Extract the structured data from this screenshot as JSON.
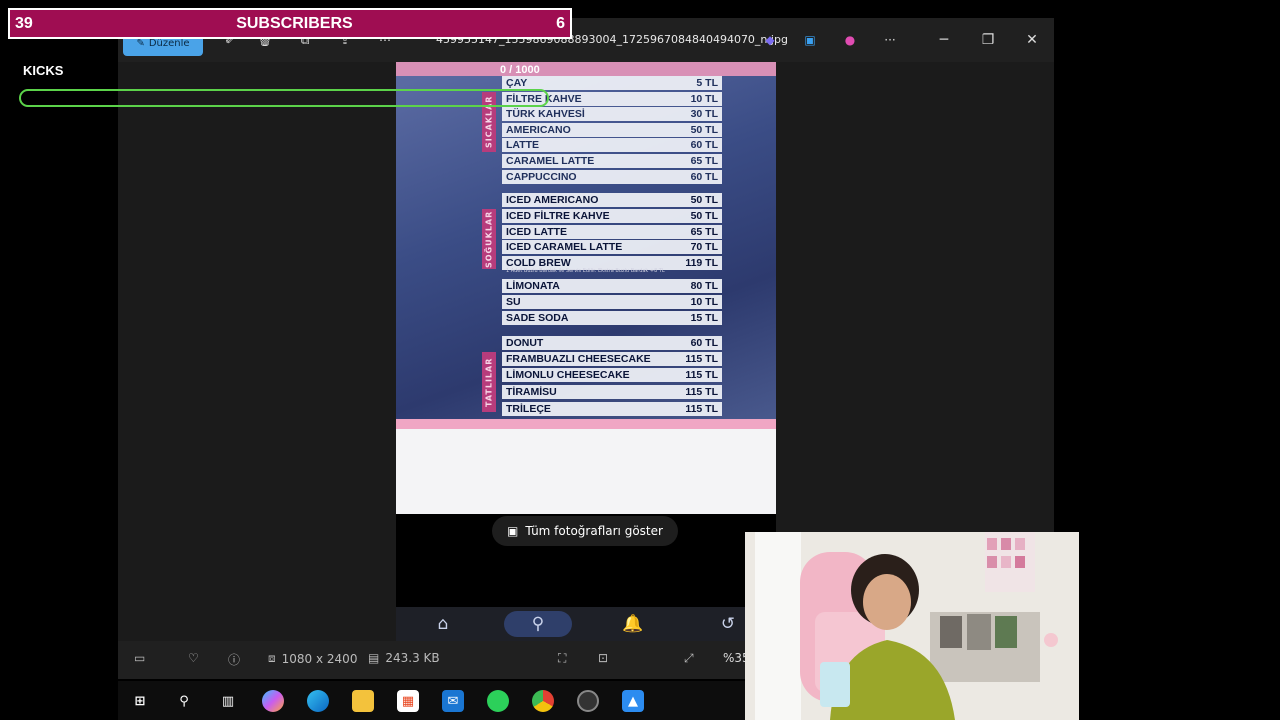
{
  "overlay": {
    "left_count": "39",
    "title": "SUBSCRIBERS",
    "right_count": "6",
    "kicks_label": "KICKS",
    "kicks_counter": "0 / 1000",
    "kicks_progress": 0.0,
    "kicks_color": "#5cd34a",
    "banner_color": "#9f0d52"
  },
  "titlebar": {
    "edit_label": "Düzenle",
    "filename": "459955147_1559869088893004_1725967084840494070_n.jpg",
    "more_icon": "ellipsis-icon",
    "minimize_icon": "minimize-icon",
    "maximize_icon": "restore-icon",
    "close_icon": "close-icon"
  },
  "menu": {
    "sections": [
      {
        "name": "SICAKLAR",
        "items": [
          {
            "name": "ÇAY",
            "price": "5 TL"
          },
          {
            "name": "FİLTRE KAHVE",
            "price": "10 TL"
          },
          {
            "name": "TÜRK KAHVESİ",
            "price": "30 TL"
          },
          {
            "name": "AMERICANO",
            "price": "50 TL"
          },
          {
            "name": "LATTE",
            "price": "60 TL"
          },
          {
            "name": "CARAMEL LATTE",
            "price": "65 TL"
          },
          {
            "name": "CAPPUCCINO",
            "price": "60 TL"
          }
        ]
      },
      {
        "name": "SOĞUKLAR",
        "items": [
          {
            "name": "ICED AMERICANO",
            "price": "50 TL"
          },
          {
            "name": "ICED FİLTRE KAHVE",
            "price": "50 TL"
          },
          {
            "name": "ICED LATTE",
            "price": "65 TL"
          },
          {
            "name": "ICED CARAMEL LATTE",
            "price": "70 TL"
          },
          {
            "name": "COLD BREW",
            "price": "119 TL"
          },
          {
            "name": "LİMONATA",
            "price": "80 TL"
          },
          {
            "name": "SU",
            "price": "10 TL"
          },
          {
            "name": "SADE SODA",
            "price": "15 TL"
          }
        ]
      },
      {
        "name": "TATLILAR",
        "items": [
          {
            "name": "DONUT",
            "price": "60 TL"
          },
          {
            "name": "FRAMBUAZLI CHEESECAKE",
            "price": "115 TL"
          },
          {
            "name": "LİMONLU CHEESECAKE",
            "price": "115 TL"
          },
          {
            "name": "TİRAMİSU",
            "price": "115 TL"
          },
          {
            "name": "TRİLEÇE",
            "price": "115 TL"
          }
        ]
      }
    ],
    "cold_brew_note": "1 Adet Buzlu Bardak ile Servis Edilir. Ekstra Buzlu Bardak +8 TL"
  },
  "phone": {
    "show_all_label": "Tüm fotoğrafları göster",
    "nav_icons": [
      "home-icon",
      "search-icon",
      "bell-icon",
      "history-icon"
    ],
    "active_nav": "search-icon"
  },
  "bottombar": {
    "dimensions": "1080 x 2400",
    "filesize": "243.3 KB",
    "zoom": "%35"
  },
  "taskbar": {
    "apps": [
      "windows-start-icon",
      "search-icon",
      "task-view-icon",
      "copilot-icon",
      "edge-icon",
      "file-explorer-icon",
      "store-icon",
      "mail-icon",
      "xbox-icon",
      "chrome-icon",
      "obs-icon",
      "photos-icon"
    ]
  }
}
